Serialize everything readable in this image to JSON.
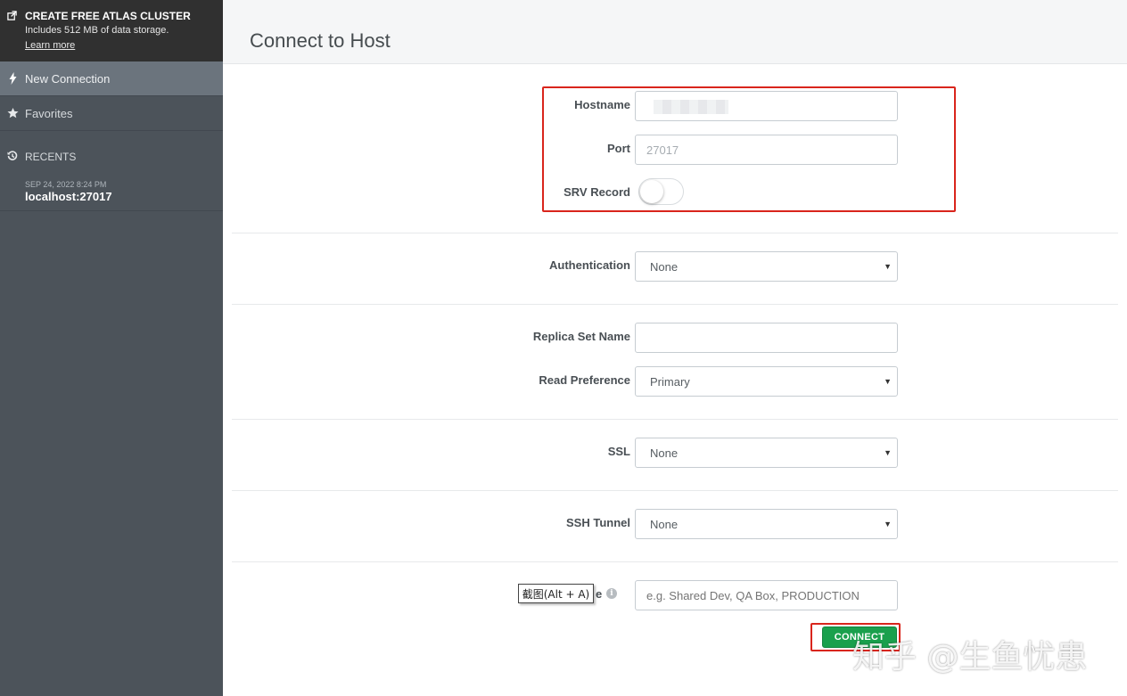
{
  "sidebar": {
    "atlas": {
      "title": "CREATE FREE ATLAS CLUSTER",
      "subtitle": "Includes 512 MB of data storage.",
      "link": "Learn more"
    },
    "nav": [
      {
        "label": "New Connection",
        "icon": "lightning-icon",
        "active": true
      },
      {
        "label": "Favorites",
        "icon": "star-icon",
        "active": false
      }
    ],
    "recents": {
      "title": "RECENTS",
      "items": [
        {
          "date": "SEP 24, 2022 8:24 PM",
          "host": "localhost:27017"
        }
      ]
    }
  },
  "main": {
    "title": "Connect to Host",
    "hostname": {
      "label": "Hostname",
      "value": ""
    },
    "port": {
      "label": "Port",
      "value": "27017"
    },
    "srv": {
      "label": "SRV Record",
      "on": false
    },
    "authentication": {
      "label": "Authentication",
      "value": "None"
    },
    "replica_set": {
      "label": "Replica Set Name",
      "value": ""
    },
    "read_preference": {
      "label": "Read Preference",
      "value": "Primary"
    },
    "ssl": {
      "label": "SSL",
      "value": "None"
    },
    "ssh_tunnel": {
      "label": "SSH Tunnel",
      "value": "None"
    },
    "favorite": {
      "label_tail": "e",
      "placeholder": "e.g. Shared Dev, QA Box, PRODUCTION"
    },
    "connect_label": "CONNECT",
    "screenshot_tooltip": "截图(Alt + A)",
    "watermark": "知乎 @生鱼忧患"
  },
  "colors": {
    "sidebar_bg": "#4c535a",
    "atlas_bg": "#303030",
    "active_nav": "#6b747d",
    "connect_green": "#1aa04d",
    "highlight_red": "#d9251c"
  }
}
